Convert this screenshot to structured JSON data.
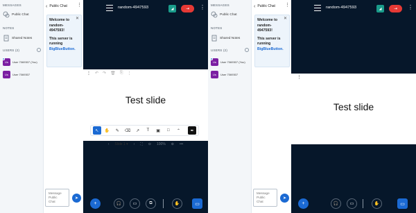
{
  "sidebar": {
    "messages_title": "MESSAGES",
    "public_chat": "Public Chat",
    "notes_title": "NOTES",
    "shared_notes": "Shared Notes",
    "users_title": "USERS (2)",
    "users": [
      {
        "initials": "Us",
        "name": "User 7069307 (You)"
      },
      {
        "initials": "Us",
        "name": "User 7069307"
      }
    ]
  },
  "chat": {
    "back_icon": "chevron-left-icon",
    "title": "Public Chat",
    "welcome_line1": "Welcome to",
    "welcome_line2": "random-",
    "welcome_line3": "4947593!",
    "welcome_line4": "This server is",
    "welcome_line5": "running",
    "welcome_link": "BigBlueButton.",
    "placeholder_l1": "Message",
    "placeholder_l2": "Public",
    "placeholder_l3": "Chat"
  },
  "presentation": {
    "meeting_title": "random-4947593",
    "slide_text": "Test slide",
    "slide_label": "Slide 1",
    "zoom": "100%"
  },
  "colors": {
    "accent": "#1b6ad3",
    "dark_bg": "#06172a",
    "record": "#1a9c8b",
    "leave": "#e53935",
    "avatar": "#7b1fa2"
  }
}
